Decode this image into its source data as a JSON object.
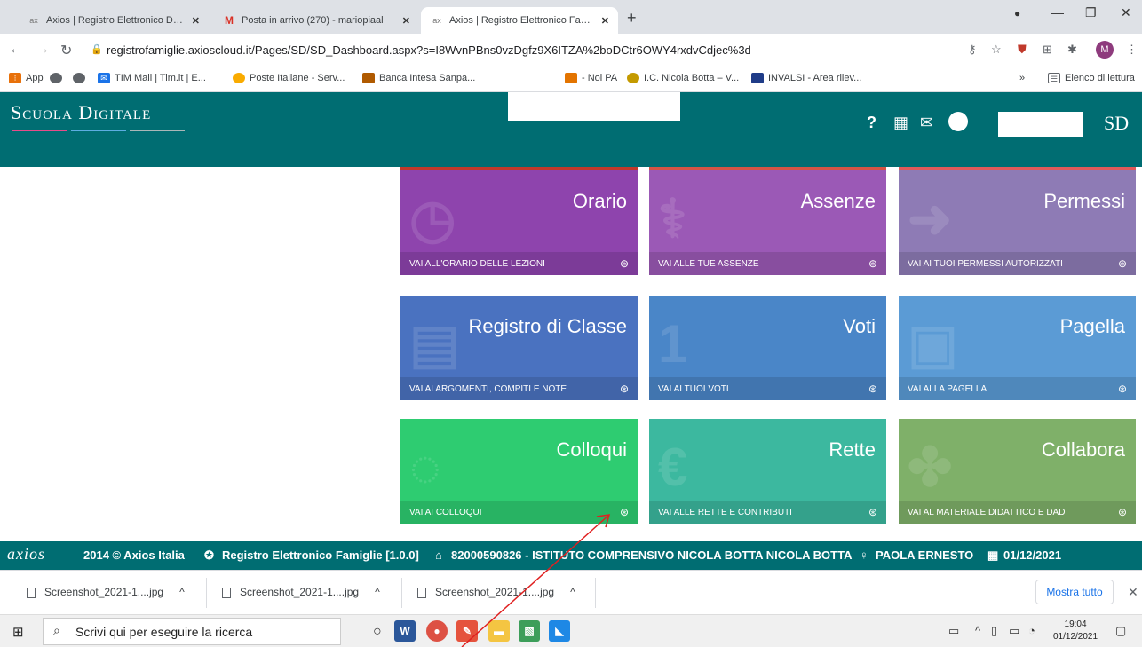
{
  "browser": {
    "tabs": [
      {
        "favicon": "axios",
        "title": "Axios | Registro Elettronico Doce",
        "active": false
      },
      {
        "favicon": "M",
        "title": "Posta in arrivo (270) - mariopiaal",
        "active": false
      },
      {
        "favicon": "axios",
        "title": "Axios | Registro Elettronico Famig",
        "active": true
      }
    ],
    "new_tab": "+",
    "url": "registrofamiglie.axioscloud.it/Pages/SD/SD_Dashboard.aspx?s=I8WvnPBns0vzDgfz9X6ITZA%2boDCtr6OWY4rxdvCdjec%3d",
    "profile_initial": "M",
    "bookmarks": [
      {
        "label": "App",
        "color": "#e8710a"
      },
      {
        "label": "",
        "color": "#5f6368"
      },
      {
        "label": "",
        "color": "#5f6368"
      },
      {
        "label": "TIM Mail | Tim.it | E...",
        "color": "#1a73e8"
      },
      {
        "label": "Poste Italiane - Serv...",
        "color": "#f9ab00"
      },
      {
        "label": "Banca Intesa Sanpa...",
        "color": "#b05a00"
      },
      {
        "label": "- Noi PA",
        "color": "#e37400"
      },
      {
        "label": "I.C. Nicola Botta – V...",
        "color": "#c49a00"
      },
      {
        "label": "INVALSI - Area rilev...",
        "color": "#1f3c88"
      }
    ],
    "bookmarks_more": "»",
    "reading_list": "Elenco di lettura"
  },
  "app": {
    "brand": "Scuola Digitale",
    "logo": "SD",
    "accent": "#006d72"
  },
  "tiles": [
    {
      "title": "Orario",
      "link": "VAI ALL'ORARIO DELLE LEZIONI",
      "color": "#8e44ad",
      "icon": "clock-icon"
    },
    {
      "title": "Assenze",
      "link": "VAI ALLE TUE ASSENZE",
      "color": "#9b59b6",
      "icon": "stethoscope-icon"
    },
    {
      "title": "Permessi",
      "link": "VAI AI TUOI PERMESSI AUTORIZZATI",
      "color": "#8e7bb5",
      "icon": "exit-icon"
    },
    {
      "title": "Registro di Classe",
      "link": "VAI AI ARGOMENTI, COMPITI E NOTE",
      "color": "#4a72c0",
      "icon": "register-icon"
    },
    {
      "title": "Voti",
      "link": "VAI AI TUOI VOTI",
      "color": "#4a86c8",
      "icon": "grade-icon"
    },
    {
      "title": "Pagella",
      "link": "VAI ALLA PAGELLA",
      "color": "#5b9bd5",
      "icon": "report-icon"
    },
    {
      "title": "Colloqui",
      "link": "VAI AI COLLOQUI",
      "color": "#2ecc71",
      "icon": "chat-icon"
    },
    {
      "title": "Rette",
      "link": "VAI ALLE RETTE E CONTRIBUTI",
      "color": "#3cb89f",
      "icon": "euro-icon"
    },
    {
      "title": "Collabora",
      "link": "VAI AL MATERIALE DIDATTICO E DAD",
      "color": "#7fb069",
      "icon": "puzzle-icon"
    }
  ],
  "footer": {
    "logo": "axios",
    "copyright": "2014 © Axios Italia",
    "product": "Registro Elettronico Famiglie [1.0.0]",
    "school": "82000590826 - ISTITUTO COMPRENSIVO NICOLA BOTTA NICOLA BOTTA",
    "user": "PAOLA ERNESTO",
    "date": "01/12/2021"
  },
  "downloads": {
    "items": [
      "Screenshot_2021-1....jpg",
      "Screenshot_2021-1....jpg",
      "Screenshot_2021-1....jpg"
    ],
    "show_all": "Mostra tutto"
  },
  "taskbar": {
    "search_placeholder": "Scrivi qui per eseguire la ricerca",
    "time": "19:04",
    "date": "01/12/2021"
  }
}
